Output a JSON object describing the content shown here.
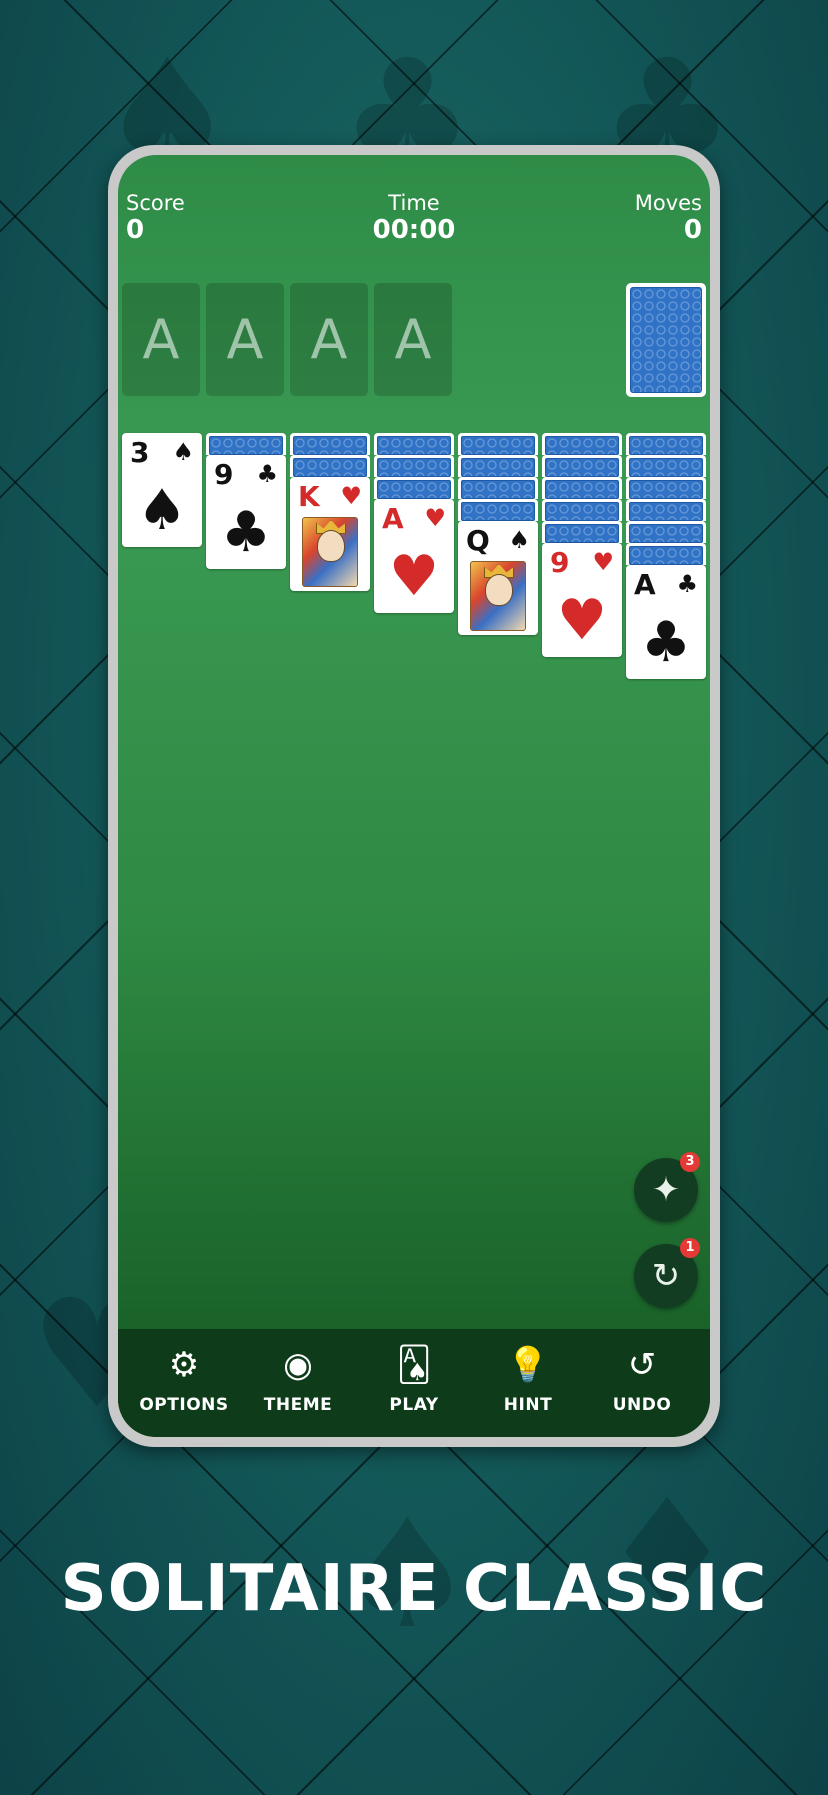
{
  "hud": {
    "score_label": "Score",
    "score_value": "0",
    "time_label": "Time",
    "time_value": "00:00",
    "moves_label": "Moves",
    "moves_value": "0"
  },
  "foundations": [
    "A",
    "A",
    "A",
    "A"
  ],
  "tableau": [
    {
      "rank": "3",
      "suit": "♠",
      "color": "black"
    },
    {
      "rank": "9",
      "suit": "♣",
      "color": "black"
    },
    {
      "rank": "K",
      "suit": "♥",
      "color": "red"
    },
    {
      "rank": "A",
      "suit": "♥",
      "color": "red"
    },
    {
      "rank": "Q",
      "suit": "♠",
      "color": "black"
    },
    {
      "rank": "9",
      "suit": "♥",
      "color": "red"
    },
    {
      "rank": "A",
      "suit": "♣",
      "color": "black"
    }
  ],
  "fabs": {
    "magic_badge": "3",
    "shuffle_badge": "1"
  },
  "bottom_nav": [
    {
      "label": "OPTIONS",
      "icon": "gear-icon"
    },
    {
      "label": "THEME",
      "icon": "palette-icon"
    },
    {
      "label": "PLAY",
      "icon": "card-icon"
    },
    {
      "label": "HINT",
      "icon": "lightbulb-icon"
    },
    {
      "label": "UNDO",
      "icon": "undo-icon"
    }
  ],
  "promo_title": "SOLITAIRE CLASSIC",
  "colors": {
    "table_green": "#2e8c47",
    "bottom_bar": "#0e3b1a",
    "card_back": "#2f72c6",
    "red_suit": "#d42a2a",
    "badge_red": "#e53935",
    "background_teal": "#145a5a"
  }
}
